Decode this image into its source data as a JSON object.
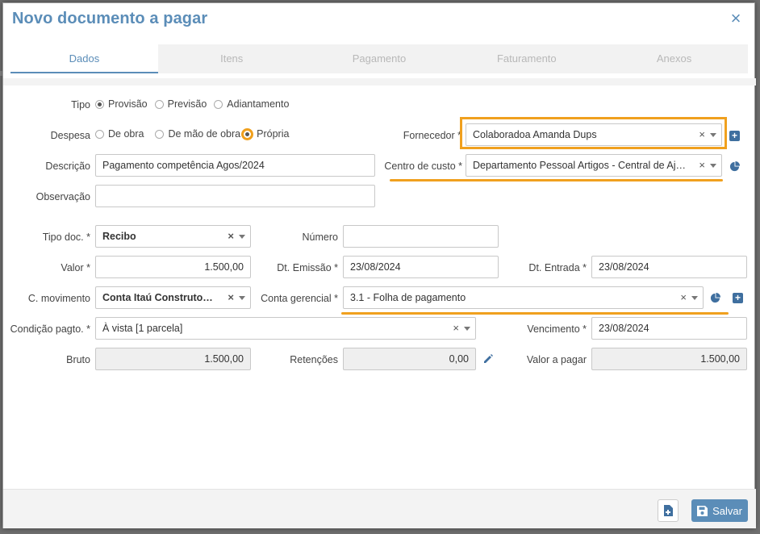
{
  "modal": {
    "title": "Novo documento a pagar"
  },
  "tabs": [
    {
      "label": "Dados",
      "active": true
    },
    {
      "label": "Itens",
      "active": false
    },
    {
      "label": "Pagamento",
      "active": false
    },
    {
      "label": "Faturamento",
      "active": false
    },
    {
      "label": "Anexos",
      "active": false
    }
  ],
  "form": {
    "tipo": {
      "label": "Tipo",
      "options": [
        "Provisão",
        "Previsão",
        "Adiantamento"
      ],
      "selected": "Provisão"
    },
    "despesa": {
      "label": "Despesa",
      "options": [
        "De obra",
        "De mão de obra",
        "Própria"
      ],
      "selected": "Própria"
    },
    "fornecedor": {
      "label": "Fornecedor *",
      "value": "Colaboradoa Amanda Dups"
    },
    "descricao": {
      "label": "Descrição",
      "value": "Pagamento competência Agos/2024"
    },
    "centro_custo": {
      "label": "Centro de custo *",
      "value": "Departamento Pessoal Artigos - Central de Ajuda"
    },
    "observacao": {
      "label": "Observação",
      "value": ""
    },
    "tipo_doc": {
      "label": "Tipo doc. *",
      "value": "Recibo"
    },
    "numero": {
      "label": "Número",
      "value": ""
    },
    "valor": {
      "label": "Valor *",
      "value": "1.500,00"
    },
    "dt_emissao": {
      "label": "Dt. Emissão *",
      "value": "23/08/2024"
    },
    "dt_entrada": {
      "label": "Dt. Entrada *",
      "value": "23/08/2024"
    },
    "c_movimento": {
      "label": "C. movimento",
      "value": "Conta Itaú Construtora - ..."
    },
    "conta_gerencial": {
      "label": "Conta gerencial *",
      "value": "3.1 - Folha de pagamento"
    },
    "condicao_pagto": {
      "label": "Condição pagto. *",
      "value": "À vista [1 parcela]"
    },
    "vencimento": {
      "label": "Vencimento *",
      "value": "23/08/2024"
    },
    "bruto": {
      "label": "Bruto",
      "value": "1.500,00"
    },
    "retencoes": {
      "label": "Retenções",
      "value": "0,00"
    },
    "valor_pagar": {
      "label": "Valor a pagar",
      "value": "1.500,00"
    }
  },
  "footer": {
    "save_label": "Salvar"
  },
  "glyphs": {
    "close": "×",
    "clear": "×",
    "plus": "+"
  },
  "colors": {
    "accent": "#5b8db8",
    "highlight": "#f0a01e",
    "icon_dark": "#3f6f9f"
  }
}
